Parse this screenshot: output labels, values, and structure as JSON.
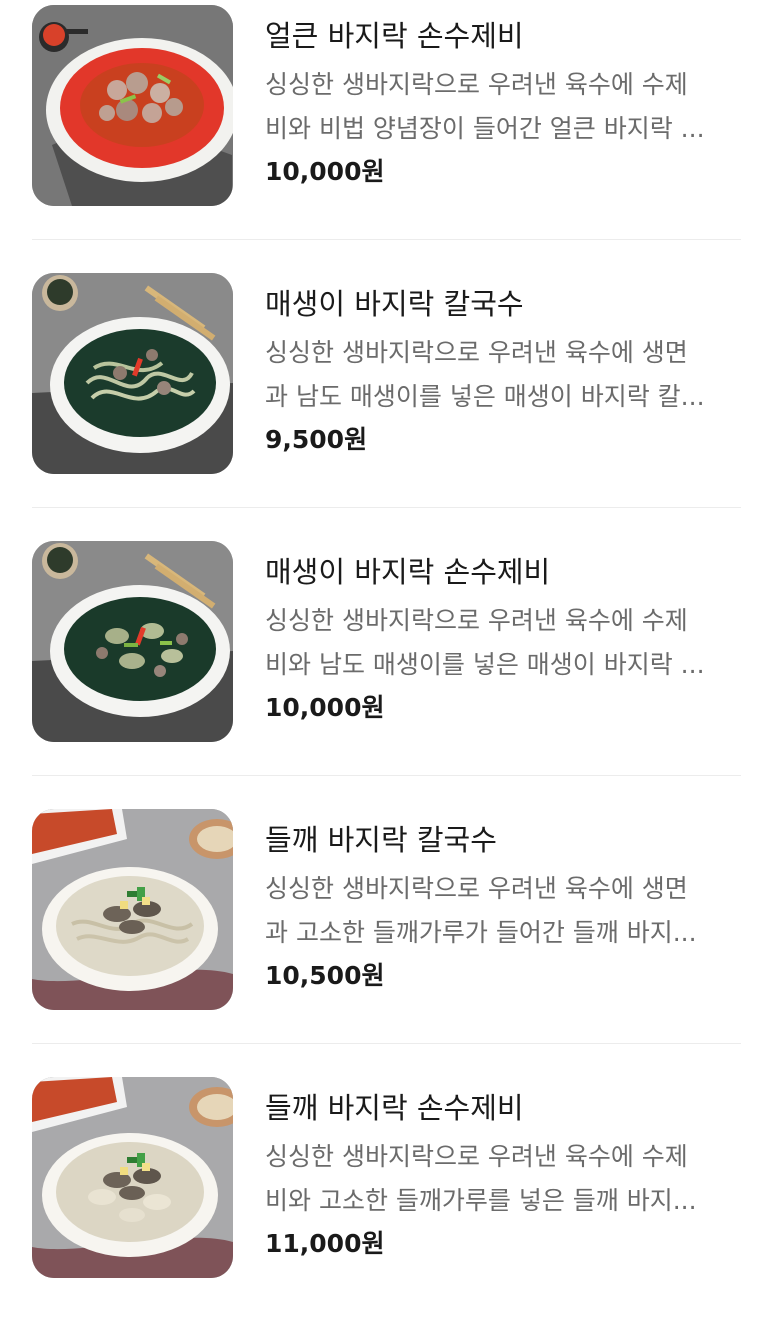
{
  "menu": {
    "items": [
      {
        "name": "얼큰 바지락 손수제비",
        "desc1": "싱싱한 생바지락으로 우려낸 육수에 수제",
        "desc2": "비와 비법 양념장이 들어간 얼큰 바지락 ...",
        "price": "10,000원",
        "image": "spicy-clam-sujebi-photo"
      },
      {
        "name": "매생이 바지락 칼국수",
        "desc1": "싱싱한 생바지락으로 우려낸 육수에 생면",
        "desc2": "과 남도 매생이를 넣은 매생이 바지락 칼...",
        "price": "9,500원",
        "image": "seaweed-clam-kalguksu-photo"
      },
      {
        "name": "매생이 바지락 손수제비",
        "desc1": "싱싱한 생바지락으로 우려낸 육수에 수제",
        "desc2": "비와 남도 매생이를 넣은 매생이 바지락 ...",
        "price": "10,000원",
        "image": "seaweed-clam-sujebi-photo"
      },
      {
        "name": "들깨 바지락 칼국수",
        "desc1": "싱싱한 생바지락으로 우려낸 육수에 생면",
        "desc2": "과 고소한 들깨가루가 들어간 들깨 바지...",
        "price": "10,500원",
        "image": "perilla-clam-kalguksu-photo"
      },
      {
        "name": "들깨 바지락 손수제비",
        "desc1": "싱싱한 생바지락으로 우려낸 육수에 수제",
        "desc2": "비와 고소한 들깨가루를 넣은 들깨 바지...",
        "price": "11,000원",
        "image": "perilla-clam-sujebi-photo"
      }
    ]
  }
}
